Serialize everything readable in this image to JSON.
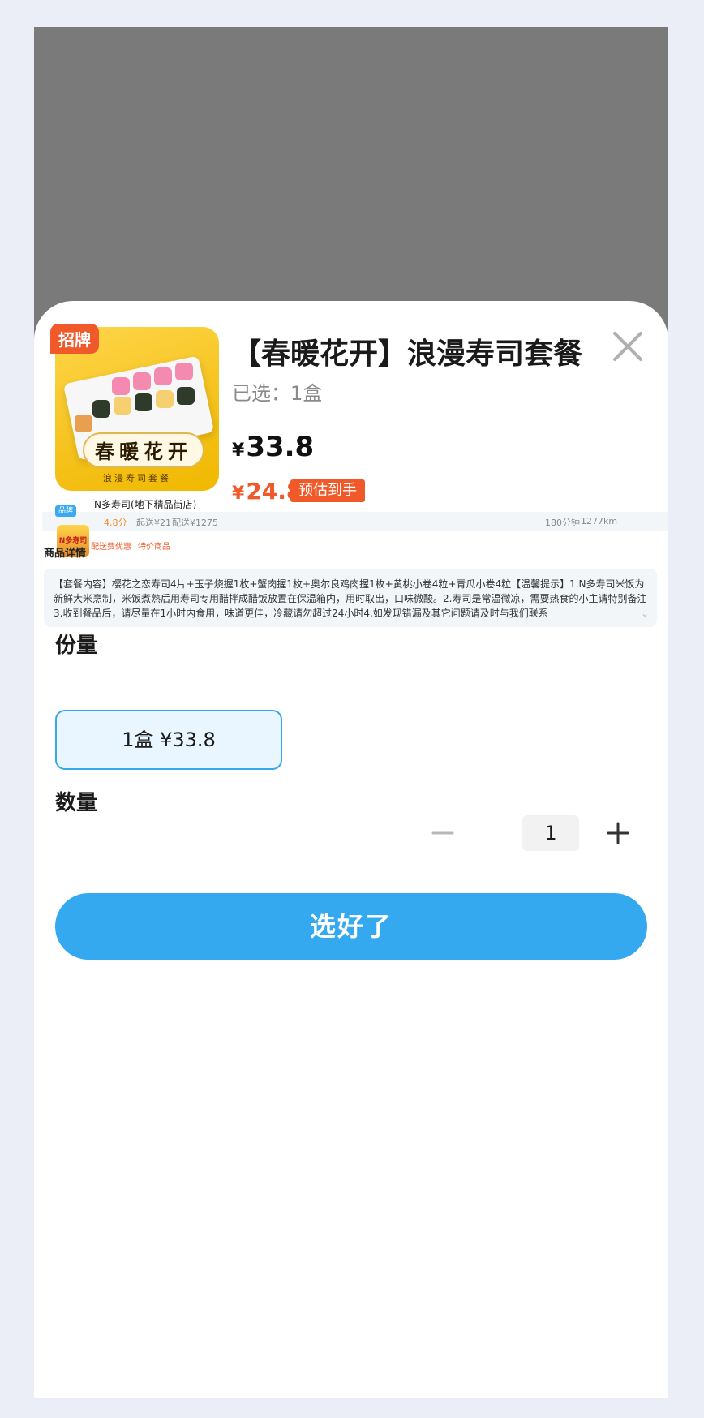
{
  "product": {
    "badge": "招牌",
    "thumb_title": "春暖花开",
    "thumb_subtitle": "浪漫寿司套餐",
    "title": "【春暖花开】浪漫寿司套餐",
    "selected": "已选：1盒",
    "price_symbol": "¥",
    "price": "33.8",
    "est_price": "24.8",
    "est_tag": "预估到手"
  },
  "store": {
    "name": "N多寿司(地下精品街店)",
    "brand_tag": "品牌",
    "logo_text": "N多寿司",
    "rating": "4.8分",
    "min_order": "起送¥21",
    "delivery_fee": "配送¥1275",
    "time": "180分钟",
    "distance": "1277km",
    "promo_fee": "配送费优惠",
    "promo_special": "特价商品"
  },
  "detail": {
    "label": "商品详情",
    "description": "【套餐内容】樱花之恋寿司4片+玉子烧握1枚+蟹肉握1枚+奥尔良鸡肉握1枚+黄桃小卷4粒+青瓜小卷4粒【温馨提示】1.N多寿司米饭为新鲜大米烹制，米饭煮熟后用寿司专用醋拌成醋饭放置在保温箱内，用时取出，口味微酸。2.寿司是常温微凉，需要热食的小主请特别备注3.收到餐品后，请尽量在1小时内食用，味道更佳，冷藏请勿超过24小时4.如发现错漏及其它问题请及时与我们联系"
  },
  "portion": {
    "title": "份量",
    "option": "1盒  ¥33.8"
  },
  "quantity": {
    "title": "数量",
    "value": "1"
  },
  "confirm_label": "选好了",
  "colors": {
    "accent": "#35a9ef",
    "price_red": "#f05a2a",
    "overlay": "#7a7a7a"
  }
}
